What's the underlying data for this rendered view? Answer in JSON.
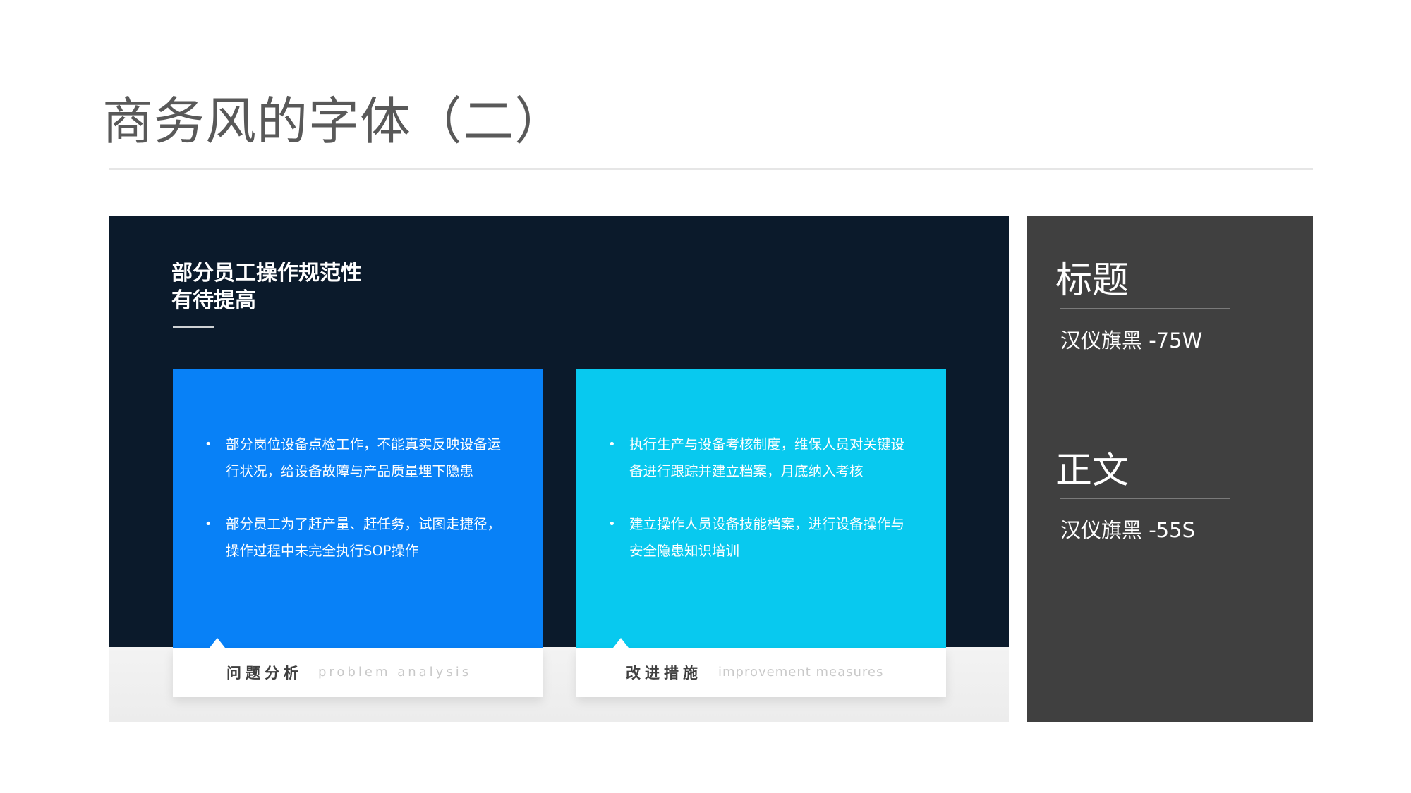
{
  "page": {
    "title": "商务风的字体（二）"
  },
  "preview": {
    "heading_line1": "部分员工操作规范性",
    "heading_line2": "有待提高",
    "cards": [
      {
        "bullets": [
          "部分岗位设备点检工作，不能真实反映设备运行状况，给设备故障与产品质量埋下隐患",
          "部分员工为了赶产量、赶任务，试图走捷径，操作过程中未完全执行SOP操作"
        ],
        "label_cn": "问题分析",
        "label_en": "problem analysis"
      },
      {
        "bullets": [
          "执行生产与设备考核制度，维保人员对关键设备进行跟踪并建立档案，月底纳入考核",
          "建立操作人员设备技能档案，进行设备操作与安全隐患知识培训"
        ],
        "label_cn": "改进措施",
        "label_en": "improvement measures"
      }
    ],
    "bullet_glyph": "•"
  },
  "side": {
    "title_label": "标题",
    "title_font": "汉仪旗黑 -75W",
    "body_label": "正文",
    "body_font": "汉仪旗黑 -55S"
  },
  "colors": {
    "card_left": "#0881f7",
    "card_right": "#08c9ef",
    "preview_bg": "#0b1a2b",
    "side_bg": "#404040"
  }
}
